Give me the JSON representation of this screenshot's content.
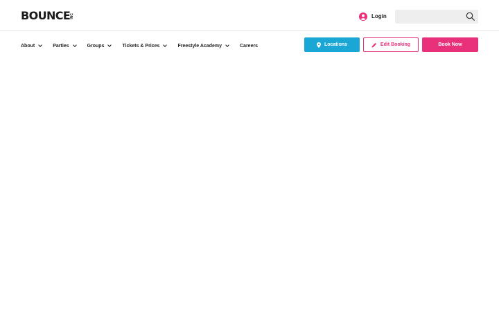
{
  "header": {
    "logo_text": "BOUNCE",
    "logo_suffix": "INC",
    "login_label": "Login",
    "search_placeholder": ""
  },
  "nav": {
    "items": [
      {
        "label": "About",
        "has_dropdown": true
      },
      {
        "label": "Parties",
        "has_dropdown": true
      },
      {
        "label": "Groups",
        "has_dropdown": true
      },
      {
        "label": "Tickets & Prices",
        "has_dropdown": true
      },
      {
        "label": "Freestyle Academy",
        "has_dropdown": true
      },
      {
        "label": "Careers",
        "has_dropdown": false
      }
    ]
  },
  "actions": {
    "locations_label": "Locations",
    "edit_booking_label": "Edit Booking",
    "book_now_label": "Book Now"
  },
  "colors": {
    "pink": "#e8317a",
    "blue": "#1aa7d6",
    "dark": "#1b1b1b"
  },
  "icons": {
    "user": "user-circle-icon",
    "search": "search-icon",
    "location": "map-pin-icon",
    "edit": "pencil-icon",
    "dropdown": "chevron-down-icon"
  }
}
